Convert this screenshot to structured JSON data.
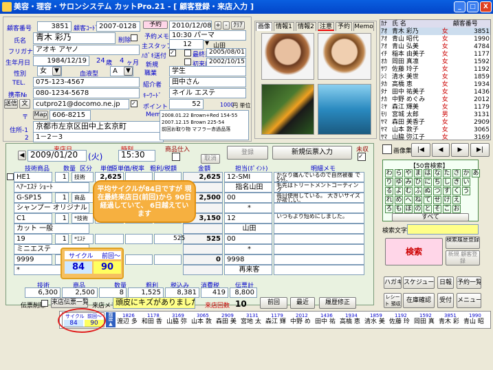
{
  "window": {
    "title": "美容・理容・サロンシステム カットPro.21 - [ 顧客登録・来店入力 ]",
    "min": "_",
    "max": "□",
    "close": "X"
  },
  "customer": {
    "no_label": "顧客番号",
    "no": "3851",
    "code_label": "顧客ｺｰﾄﾞ",
    "code": "2007-0128",
    "name_label": "氏名",
    "name": "青木 彩乃",
    "deleted_label": "削除",
    "kana_label": "フリガナ",
    "kana": "アオキ アヤノ",
    "birth_label": "生年月日",
    "birth": "1984/12/19",
    "age": "24",
    "age_unit": "歳",
    "months": "4",
    "months_unit": "ヶ月",
    "sex_label": "性別",
    "sex": "女",
    "blood_label": "血液型",
    "blood": "A",
    "tel_label": "TEL.",
    "tel": "075-123-4567",
    "mobile_label": "携帯№",
    "mobile": "080-1234-5678",
    "mail_send": "送信",
    "mail_txt": "文",
    "mail": "cutpro21@docomo.ne.jp",
    "zip_label": "〒",
    "map_btn": "Map",
    "zip": "606-8215",
    "addr1_label": "住所-1",
    "addr1": "京都市左京区田中上玄京町",
    "addr2_label": "2",
    "addr2": "1－2－3"
  },
  "reserve": {
    "btn": "予約",
    "memo_label": "予約メモ",
    "date": "2010/12/08",
    "plus": "+",
    "minus": "-",
    "clear": "ｸﾘｱ",
    "memo": "10:30 パーマ",
    "staff_label": "主スタッフ",
    "staff_no": "12",
    "staff": "山田",
    "dm_label": "ﾊｶﾞｷ送付",
    "last_visit_label": "最終来店",
    "last_visit": "2005/08/01",
    "new_label": "新規",
    "first_visit_label": "初来店日",
    "first_visit": "2002/10/15",
    "job_label": "職業",
    "job": "学生",
    "intro_label": "紹介者",
    "intro": "田中さん",
    "keyword_label": "ｷｰﾜｰﾄﾞ",
    "keyword": "ネイル エステ",
    "point_label": "ポイント",
    "point": "52",
    "unit_price": "1000",
    "unit_label": "円 単位",
    "memo2_label": "Memo",
    "memo_lines": [
      "2008.01.22 Brown+Red 154-55",
      "",
      "2007.12.15 Brown 225-54",
      "前回お取り物 マフラー赤過品落"
    ]
  },
  "tabs": [
    "画像",
    "情報1",
    "情報2",
    "注意",
    "予約",
    "Memo"
  ],
  "clist": {
    "headers": [
      "ｶﾅ",
      "氏 名",
      "",
      "顧客番号"
    ],
    "rows": [
      [
        "ｱｵ",
        "青木 彩乃",
        "女",
        "3851"
      ],
      [
        "ｱｵ",
        "青山 昭代",
        "女",
        "1990"
      ],
      [
        "ｱｵ",
        "青山 弘美",
        "女",
        "4784"
      ],
      [
        "ｲﾁ",
        "稲本 由美子",
        "女",
        "1177"
      ],
      [
        "ｵｶ",
        "岡田 真凛",
        "女",
        "1592"
      ],
      [
        "ｻﾜ",
        "佐藤 玲子",
        "女",
        "1192"
      ],
      [
        "ｼﾐ",
        "清水 美世",
        "女",
        "1859"
      ],
      [
        "ﾀｶ",
        "高橋 恵",
        "女",
        "1934"
      ],
      [
        "ﾀﾅ",
        "田中 祐美子",
        "女",
        "1436"
      ],
      [
        "ﾅｶ",
        "中野 めぐみ",
        "女",
        "2012"
      ],
      [
        "ﾐﾔ",
        "森江 輝美",
        "女",
        "1179"
      ],
      [
        "ﾓﾘ",
        "宮城 太郎",
        "男",
        "3131"
      ],
      [
        "ﾔﾏ",
        "森田 美香子",
        "女",
        "2909"
      ],
      [
        "ﾔﾏ",
        "山本 敦子",
        "女",
        "3065"
      ],
      [
        "ﾔﾏ",
        "山脇 弥江子",
        "女",
        "3169"
      ]
    ]
  },
  "visit": {
    "date_label": "来店日",
    "date": "2009/01/20",
    "dow": "(火)",
    "time_label": "時刻",
    "time": "15:30",
    "goods_label": "商品仕入",
    "cancel": "取消",
    "register": "登録",
    "new_slip": "新規伝票入力",
    "pay_label": "未収"
  },
  "slip": {
    "headers": [
      "技術商品",
      "数量",
      "区分",
      "単価",
      "原単価/税率",
      "粗利/税額",
      "金額",
      "担当(ﾎﾟｲﾝﾄ)",
      "明細メモ"
    ],
    "rows": [
      {
        "code": "HE1",
        "qty": "1",
        "kind": "技術",
        "price": "2,625",
        "amount": "2,625",
        "staff": "12-SMI",
        "memo": "かなり痛んでいるので自然被覆 で5分。"
      },
      {
        "code": "ﾍｱｰｴｽﾃ ｼｮｰﾄ",
        "qty": "",
        "kind": "",
        "price": "",
        "amount": "",
        "staff": "指名山田",
        "memo": "毛先はトリートメントコーティン グ"
      },
      {
        "code": "G-SP15",
        "qty": "1",
        "kind": "商品",
        "price": "2,500",
        "amount": "2,500",
        "staff": "00",
        "memo": "毎日使用している。 大きいサイズが欲しい。"
      },
      {
        "code": "シャンプー オリジナル",
        "qty": "",
        "kind": "",
        "price": "",
        "amount": "",
        "staff": "*",
        "memo": ""
      },
      {
        "code": "C1",
        "qty": "1",
        "kind": "*技術",
        "price": "",
        "amount": "3,150",
        "staff": "12",
        "memo": "いつもより短めにしました。"
      },
      {
        "code": "カット 一般",
        "qty": "",
        "kind": "",
        "price": "",
        "amount": "",
        "staff": "山田",
        "memo": ""
      },
      {
        "code": "19",
        "qty": "1",
        "kind": "*ｴｽﾃ",
        "price": "",
        "amount": "525",
        "staff": "00",
        "memo": ""
      },
      {
        "code": "ミニエステ",
        "qty": "",
        "kind": "",
        "price": "",
        "amount": "",
        "staff": "*",
        "memo": ""
      },
      {
        "code": "9999",
        "qty": "1",
        "kind": "",
        "price": "",
        "amount": "0",
        "staff": "9998",
        "memo": ""
      },
      {
        "code": "*",
        "qty": "",
        "kind": "",
        "price": "",
        "amount": "",
        "staff": "再来客",
        "memo": ""
      }
    ],
    "cost_col": [
      "525"
    ]
  },
  "totals": {
    "labels": [
      "技術",
      "商品",
      "数量",
      "粗利",
      "税込み",
      "消費税",
      "伝票計"
    ],
    "values": [
      "6,300",
      "2,500",
      "8",
      "1,525",
      "8,381",
      "419",
      "8,800"
    ]
  },
  "footer": {
    "slip_delete": "伝票削除",
    "slip_list": "来店伝票一覧",
    "memo_label": "来店メモ",
    "memo": "頭皮にキズがありました",
    "count_label": "来店回数",
    "count": "10",
    "prev": "前回",
    "last": "最近",
    "history": "履歴修正"
  },
  "callout": {
    "text": "平均サイクルが84日ですが 現在最終来店日(前回)から 90日経過していて、 6日越えています"
  },
  "cycle": {
    "label": "サイクル",
    "prev_label": "前回～",
    "value": "84",
    "prev": "90"
  },
  "right": {
    "image_btn": "画像集",
    "nav": [
      "|◀",
      "◀",
      "▶",
      "▶|"
    ],
    "kana_title": "【50音検索】",
    "kana_rows": [
      "わらやまはなたさかあ",
      "りゆみひにちしきい",
      "るよむふぬつすくう",
      "れめへねてせけえ",
      "ろもほのとそこお"
    ],
    "all": "すべて",
    "search_label": "検索文字",
    "search": "検索",
    "hist_btn": "検索履歴登録",
    "new_btn": "新規 顧客登録",
    "btns": [
      "ハガキ",
      "スケジュール",
      "日報",
      "予約一覧",
      "レシート 預収書",
      "在庫確認",
      "受付",
      "メニュー"
    ]
  },
  "bottom": {
    "cycle_label": "サイクル",
    "prev_label": "前回～",
    "cycle": "84",
    "prev": "90",
    "list": [
      [
        "1826",
        "渡辺 多"
      ],
      [
        "1178",
        "和田 香"
      ],
      [
        "3169",
        "山脇 弥"
      ],
      [
        "3065",
        "山本 敦"
      ],
      [
        "2909",
        "森田 美"
      ],
      [
        "3131",
        "宮地 太"
      ],
      [
        "1179",
        "森江 輝"
      ],
      [
        "2012",
        "中野 め"
      ],
      [
        "1436",
        "田中 祐"
      ],
      [
        "1934",
        "高橋 恵"
      ],
      [
        "1859",
        "清水 美"
      ],
      [
        "1192",
        "佐藤 玲"
      ],
      [
        "1592",
        "岡田 真"
      ],
      [
        "3851",
        "青木 彩"
      ],
      [
        "1990",
        "青山 昭"
      ]
    ]
  }
}
